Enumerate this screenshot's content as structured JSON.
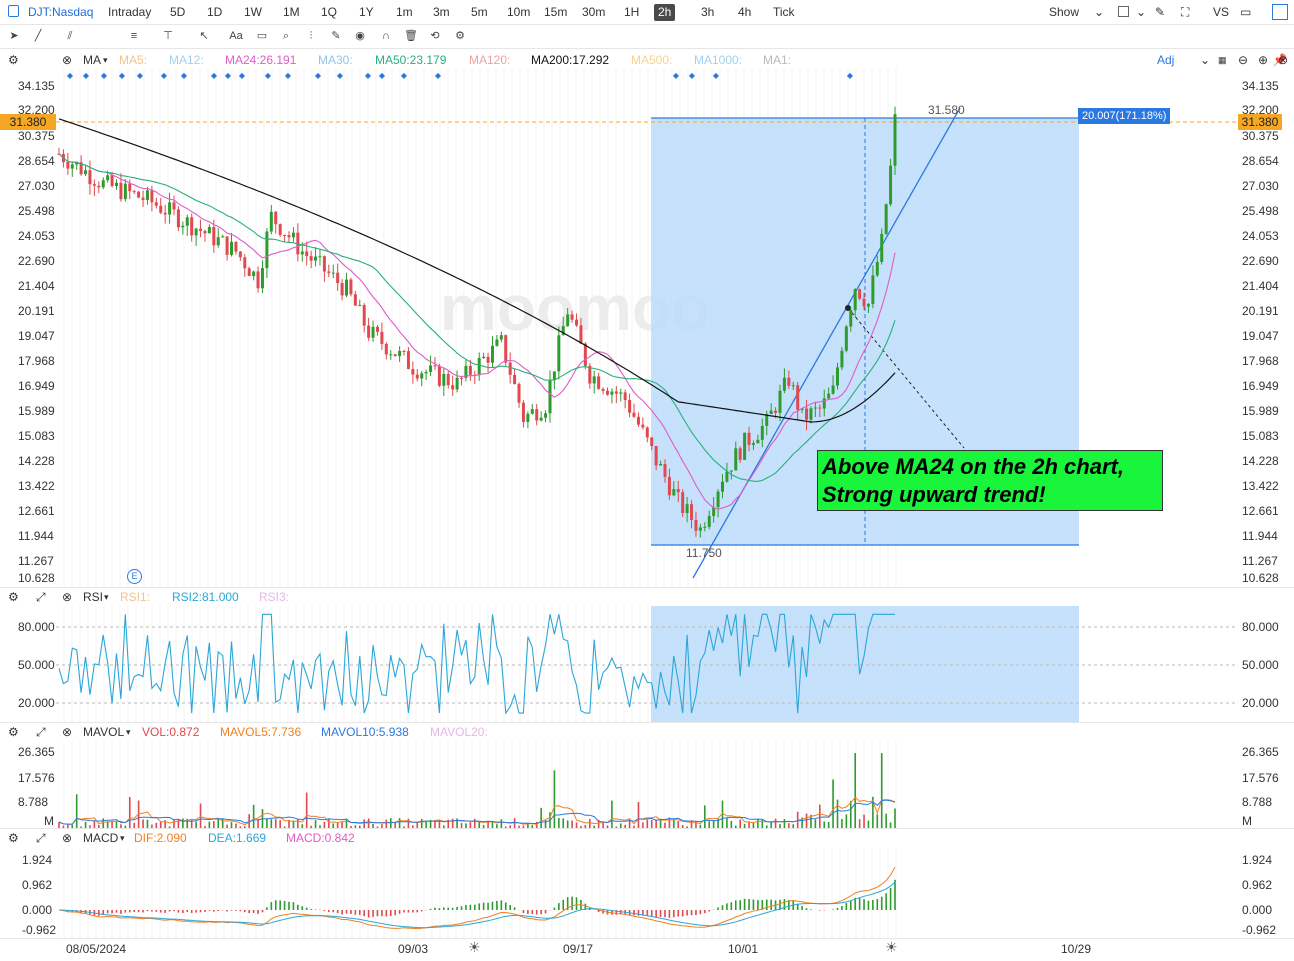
{
  "toolbar": {
    "symbol": "DJT:Nasdaq",
    "timeframes": [
      "Intraday",
      "5D",
      "1D",
      "1W",
      "1M",
      "1Q",
      "1Y",
      "1m",
      "3m",
      "5m",
      "10m",
      "15m",
      "30m",
      "1H",
      "2h",
      "3h",
      "4h",
      "Tick"
    ],
    "active_timeframe": "2h",
    "show_label": "Show",
    "vs_label": "VS"
  },
  "drawing_tools": [
    "cursor-icon",
    "line-icon",
    "channel-icon",
    "fib-icon",
    "ruler-icon",
    "arrow-icon",
    "text-icon",
    "comment-icon",
    "zoom-icon",
    "indicator-icon",
    "pencil-icon",
    "eye-icon",
    "magnet-icon",
    "trash-icon",
    "sync-icon",
    "settings-icon"
  ],
  "main_legend": {
    "ma_label": "MA",
    "ma5": "MA5:",
    "ma12": "MA12:",
    "ma24": "MA24:26.191",
    "ma30": "MA30:",
    "ma50": "MA50:23.179",
    "ma120": "MA120:",
    "ma200": "MA200:17.292",
    "ma500": "MA500:",
    "ma1000": "MA1000:",
    "ma1": "MA1:",
    "adj": "Adj"
  },
  "price_axis": [
    "34.135",
    "32.200",
    "30.375",
    "28.654",
    "27.030",
    "25.498",
    "24.053",
    "22.690",
    "21.404",
    "20.191",
    "19.047",
    "17.968",
    "16.949",
    "15.989",
    "15.083",
    "14.228",
    "13.422",
    "12.661",
    "11.944",
    "11.267",
    "10.628"
  ],
  "current_price": "31.380",
  "measure": {
    "top_label": "31.580",
    "bottom_label": "11.750",
    "change_label": "20.007(171.18%)"
  },
  "annotation": {
    "line1": "Above MA24 on the 2h chart,",
    "line2": "Strong upward trend!"
  },
  "watermark": "moomoo",
  "rsi": {
    "label": "RSI",
    "rsi1": "RSI1:",
    "rsi2": "RSI2:81.000",
    "rsi3": "RSI3:",
    "axis": [
      "80.000",
      "50.000",
      "20.000"
    ]
  },
  "mavol": {
    "label": "MAVOL",
    "vol": "VOL:0.872",
    "mavol5": "MAVOL5:7.736",
    "mavol10": "MAVOL10:5.938",
    "mavol20": "MAVOL20:",
    "axis": [
      "26.365",
      "17.576",
      "8.788"
    ],
    "unit": "M"
  },
  "macd": {
    "label": "MACD",
    "dif": "DIF:2.090",
    "dea": "DEA:1.669",
    "macd": "MACD:0.842",
    "axis": [
      "1.924",
      "0.962",
      "0.000",
      "-0.962"
    ]
  },
  "dates": [
    "08/05/2024",
    "09/03",
    "09/17",
    "10/01",
    "10/29"
  ],
  "colors": {
    "ma24": "#e05cc8",
    "ma50": "#27b07a",
    "ma200": "#111111",
    "up": "#2e9b2e",
    "down": "#e0494f",
    "rsi": "#2aa7d8",
    "box": "#bcdcfa",
    "accent": "#2a79e0"
  }
}
